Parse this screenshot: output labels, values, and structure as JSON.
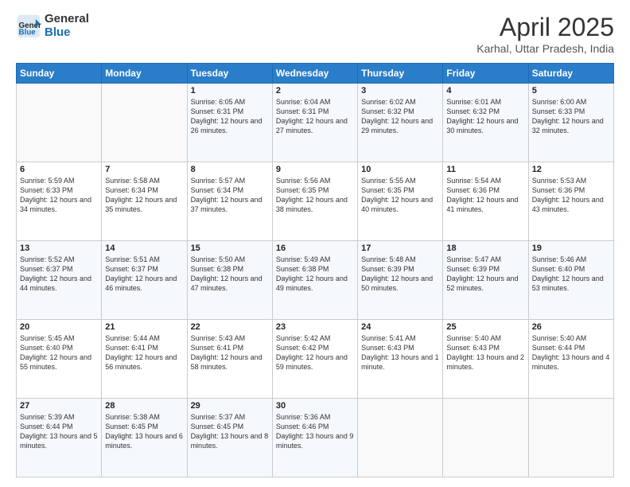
{
  "header": {
    "logo_line1": "General",
    "logo_line2": "Blue",
    "title": "April 2025",
    "location": "Karhal, Uttar Pradesh, India"
  },
  "columns": [
    "Sunday",
    "Monday",
    "Tuesday",
    "Wednesday",
    "Thursday",
    "Friday",
    "Saturday"
  ],
  "weeks": [
    [
      {
        "day": "",
        "content": ""
      },
      {
        "day": "",
        "content": ""
      },
      {
        "day": "1",
        "content": "Sunrise: 6:05 AM\nSunset: 6:31 PM\nDaylight: 12 hours and 26 minutes."
      },
      {
        "day": "2",
        "content": "Sunrise: 6:04 AM\nSunset: 6:31 PM\nDaylight: 12 hours and 27 minutes."
      },
      {
        "day": "3",
        "content": "Sunrise: 6:02 AM\nSunset: 6:32 PM\nDaylight: 12 hours and 29 minutes."
      },
      {
        "day": "4",
        "content": "Sunrise: 6:01 AM\nSunset: 6:32 PM\nDaylight: 12 hours and 30 minutes."
      },
      {
        "day": "5",
        "content": "Sunrise: 6:00 AM\nSunset: 6:33 PM\nDaylight: 12 hours and 32 minutes."
      }
    ],
    [
      {
        "day": "6",
        "content": "Sunrise: 5:59 AM\nSunset: 6:33 PM\nDaylight: 12 hours and 34 minutes."
      },
      {
        "day": "7",
        "content": "Sunrise: 5:58 AM\nSunset: 6:34 PM\nDaylight: 12 hours and 35 minutes."
      },
      {
        "day": "8",
        "content": "Sunrise: 5:57 AM\nSunset: 6:34 PM\nDaylight: 12 hours and 37 minutes."
      },
      {
        "day": "9",
        "content": "Sunrise: 5:56 AM\nSunset: 6:35 PM\nDaylight: 12 hours and 38 minutes."
      },
      {
        "day": "10",
        "content": "Sunrise: 5:55 AM\nSunset: 6:35 PM\nDaylight: 12 hours and 40 minutes."
      },
      {
        "day": "11",
        "content": "Sunrise: 5:54 AM\nSunset: 6:36 PM\nDaylight: 12 hours and 41 minutes."
      },
      {
        "day": "12",
        "content": "Sunrise: 5:53 AM\nSunset: 6:36 PM\nDaylight: 12 hours and 43 minutes."
      }
    ],
    [
      {
        "day": "13",
        "content": "Sunrise: 5:52 AM\nSunset: 6:37 PM\nDaylight: 12 hours and 44 minutes."
      },
      {
        "day": "14",
        "content": "Sunrise: 5:51 AM\nSunset: 6:37 PM\nDaylight: 12 hours and 46 minutes."
      },
      {
        "day": "15",
        "content": "Sunrise: 5:50 AM\nSunset: 6:38 PM\nDaylight: 12 hours and 47 minutes."
      },
      {
        "day": "16",
        "content": "Sunrise: 5:49 AM\nSunset: 6:38 PM\nDaylight: 12 hours and 49 minutes."
      },
      {
        "day": "17",
        "content": "Sunrise: 5:48 AM\nSunset: 6:39 PM\nDaylight: 12 hours and 50 minutes."
      },
      {
        "day": "18",
        "content": "Sunrise: 5:47 AM\nSunset: 6:39 PM\nDaylight: 12 hours and 52 minutes."
      },
      {
        "day": "19",
        "content": "Sunrise: 5:46 AM\nSunset: 6:40 PM\nDaylight: 12 hours and 53 minutes."
      }
    ],
    [
      {
        "day": "20",
        "content": "Sunrise: 5:45 AM\nSunset: 6:40 PM\nDaylight: 12 hours and 55 minutes."
      },
      {
        "day": "21",
        "content": "Sunrise: 5:44 AM\nSunset: 6:41 PM\nDaylight: 12 hours and 56 minutes."
      },
      {
        "day": "22",
        "content": "Sunrise: 5:43 AM\nSunset: 6:41 PM\nDaylight: 12 hours and 58 minutes."
      },
      {
        "day": "23",
        "content": "Sunrise: 5:42 AM\nSunset: 6:42 PM\nDaylight: 12 hours and 59 minutes."
      },
      {
        "day": "24",
        "content": "Sunrise: 5:41 AM\nSunset: 6:43 PM\nDaylight: 13 hours and 1 minute."
      },
      {
        "day": "25",
        "content": "Sunrise: 5:40 AM\nSunset: 6:43 PM\nDaylight: 13 hours and 2 minutes."
      },
      {
        "day": "26",
        "content": "Sunrise: 5:40 AM\nSunset: 6:44 PM\nDaylight: 13 hours and 4 minutes."
      }
    ],
    [
      {
        "day": "27",
        "content": "Sunrise: 5:39 AM\nSunset: 6:44 PM\nDaylight: 13 hours and 5 minutes."
      },
      {
        "day": "28",
        "content": "Sunrise: 5:38 AM\nSunset: 6:45 PM\nDaylight: 13 hours and 6 minutes."
      },
      {
        "day": "29",
        "content": "Sunrise: 5:37 AM\nSunset: 6:45 PM\nDaylight: 13 hours and 8 minutes."
      },
      {
        "day": "30",
        "content": "Sunrise: 5:36 AM\nSunset: 6:46 PM\nDaylight: 13 hours and 9 minutes."
      },
      {
        "day": "",
        "content": ""
      },
      {
        "day": "",
        "content": ""
      },
      {
        "day": "",
        "content": ""
      }
    ]
  ]
}
